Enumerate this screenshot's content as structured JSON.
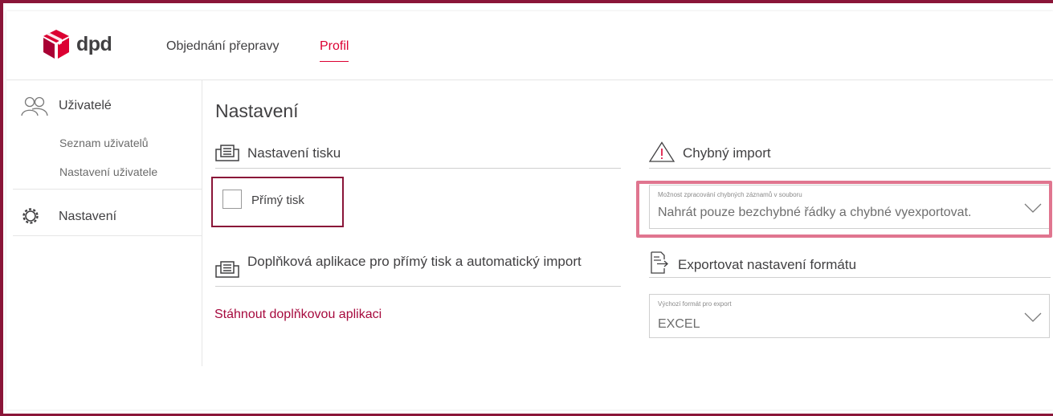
{
  "brand": {
    "logo_text": "dpd",
    "accent_color": "#dc0032",
    "frame_color": "#8a1538"
  },
  "nav": {
    "items": [
      {
        "label": "Objednání přepravy",
        "active": false
      },
      {
        "label": "Profil",
        "active": true
      }
    ]
  },
  "sidebar": {
    "users": {
      "title": "Uživatelé",
      "icon": "users-icon",
      "items": [
        {
          "label": "Seznam uživatelů"
        },
        {
          "label": "Nastavení uživatele"
        }
      ]
    },
    "settings": {
      "title": "Nastavení",
      "icon": "gear-icon"
    }
  },
  "main": {
    "title": "Nastavení",
    "print_settings": {
      "heading": "Nastavení tisku",
      "icon": "printer-icon",
      "direct_print_label": "Přímý tisk",
      "direct_print_checked": false
    },
    "addon_app": {
      "heading": "Doplňková aplikace pro přímý tisk a automatický import",
      "icon": "printer-icon",
      "download_link": "Stáhnout doplňkovou aplikaci"
    },
    "bad_import": {
      "heading": "Chybný import",
      "icon": "warning-icon",
      "select_label": "Možnost zpracování chybných záznamů v souboru",
      "select_value": "Nahrát pouze bezchybné řádky a chybné vyexportovat."
    },
    "export_format": {
      "heading": "Exportovat nastavení formátu",
      "icon": "export-file-icon",
      "select_label": "Výchozí formát pro export",
      "select_value": "EXCEL"
    }
  }
}
